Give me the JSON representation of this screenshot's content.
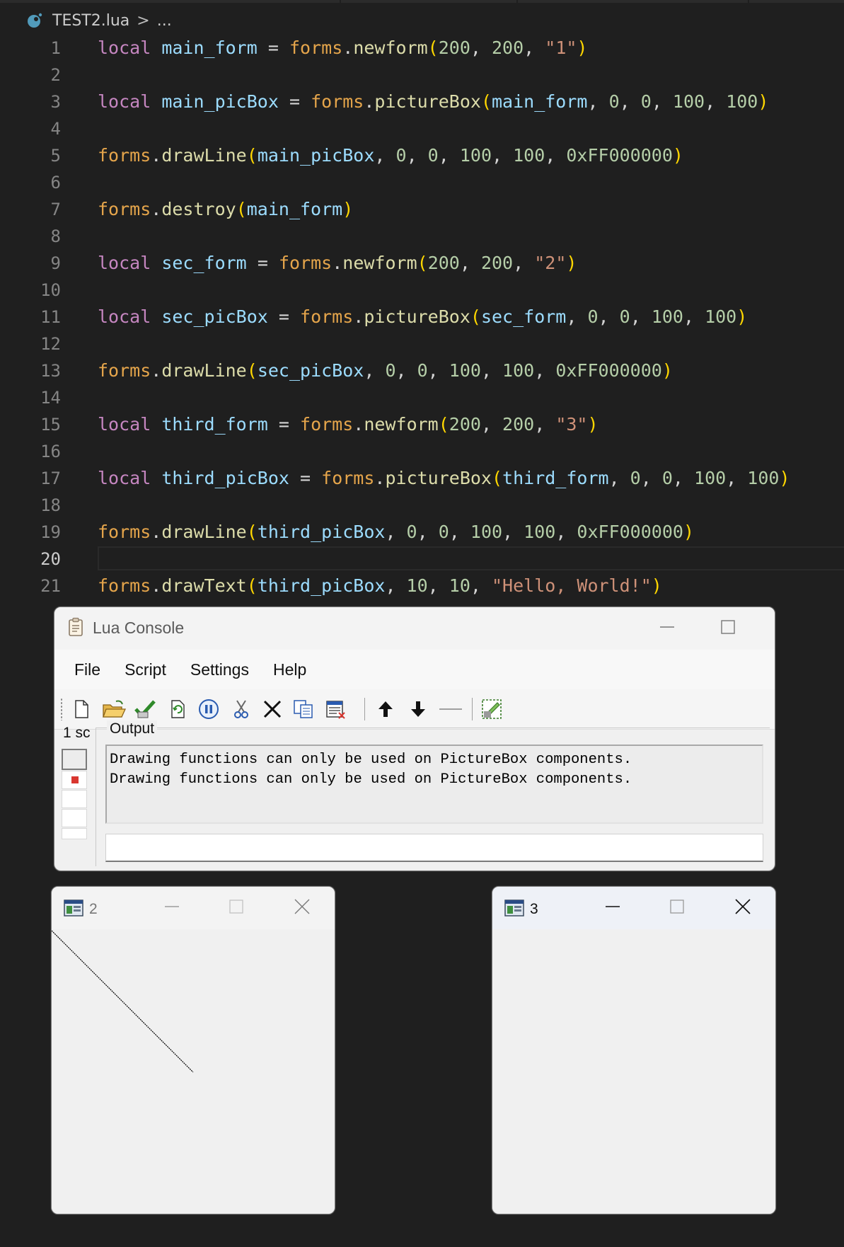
{
  "editor": {
    "breadcrumb": {
      "file": "TEST2.lua",
      "separator": ">",
      "rest": "..."
    },
    "active_line": 20,
    "lines": [
      {
        "n": "1",
        "tokens": [
          [
            "kw",
            "local"
          ],
          [
            "pl",
            " "
          ],
          [
            "var",
            "main_form"
          ],
          [
            "pl",
            " "
          ],
          [
            "op",
            "="
          ],
          [
            "pl",
            " "
          ],
          [
            "lib",
            "forms"
          ],
          [
            "op",
            "."
          ],
          [
            "fn",
            "newform"
          ],
          [
            "p1",
            "("
          ],
          [
            "num",
            "200"
          ],
          [
            "pl",
            ", "
          ],
          [
            "num",
            "200"
          ],
          [
            "pl",
            ", "
          ],
          [
            "str",
            "\"1\""
          ],
          [
            "p1",
            ")"
          ]
        ]
      },
      {
        "n": "2",
        "tokens": []
      },
      {
        "n": "3",
        "tokens": [
          [
            "kw",
            "local"
          ],
          [
            "pl",
            " "
          ],
          [
            "var",
            "main_picBox"
          ],
          [
            "pl",
            " "
          ],
          [
            "op",
            "="
          ],
          [
            "pl",
            " "
          ],
          [
            "lib",
            "forms"
          ],
          [
            "op",
            "."
          ],
          [
            "fn",
            "pictureBox"
          ],
          [
            "p1",
            "("
          ],
          [
            "var",
            "main_form"
          ],
          [
            "pl",
            ", "
          ],
          [
            "num",
            "0"
          ],
          [
            "pl",
            ", "
          ],
          [
            "num",
            "0"
          ],
          [
            "pl",
            ", "
          ],
          [
            "num",
            "100"
          ],
          [
            "pl",
            ", "
          ],
          [
            "num",
            "100"
          ],
          [
            "p1",
            ")"
          ]
        ]
      },
      {
        "n": "4",
        "tokens": []
      },
      {
        "n": "5",
        "tokens": [
          [
            "lib",
            "forms"
          ],
          [
            "op",
            "."
          ],
          [
            "fn",
            "drawLine"
          ],
          [
            "p1",
            "("
          ],
          [
            "var",
            "main_picBox"
          ],
          [
            "pl",
            ", "
          ],
          [
            "num",
            "0"
          ],
          [
            "pl",
            ", "
          ],
          [
            "num",
            "0"
          ],
          [
            "pl",
            ", "
          ],
          [
            "num",
            "100"
          ],
          [
            "pl",
            ", "
          ],
          [
            "num",
            "100"
          ],
          [
            "pl",
            ", "
          ],
          [
            "num",
            "0xFF000000"
          ],
          [
            "p1",
            ")"
          ]
        ]
      },
      {
        "n": "6",
        "tokens": []
      },
      {
        "n": "7",
        "tokens": [
          [
            "lib",
            "forms"
          ],
          [
            "op",
            "."
          ],
          [
            "fn",
            "destroy"
          ],
          [
            "p1",
            "("
          ],
          [
            "var",
            "main_form"
          ],
          [
            "p1",
            ")"
          ]
        ]
      },
      {
        "n": "8",
        "tokens": []
      },
      {
        "n": "9",
        "tokens": [
          [
            "kw",
            "local"
          ],
          [
            "pl",
            " "
          ],
          [
            "var",
            "sec_form"
          ],
          [
            "pl",
            " "
          ],
          [
            "op",
            "="
          ],
          [
            "pl",
            " "
          ],
          [
            "lib",
            "forms"
          ],
          [
            "op",
            "."
          ],
          [
            "fn",
            "newform"
          ],
          [
            "p1",
            "("
          ],
          [
            "num",
            "200"
          ],
          [
            "pl",
            ", "
          ],
          [
            "num",
            "200"
          ],
          [
            "pl",
            ", "
          ],
          [
            "str",
            "\"2\""
          ],
          [
            "p1",
            ")"
          ]
        ]
      },
      {
        "n": "10",
        "tokens": []
      },
      {
        "n": "11",
        "tokens": [
          [
            "kw",
            "local"
          ],
          [
            "pl",
            " "
          ],
          [
            "var",
            "sec_picBox"
          ],
          [
            "pl",
            " "
          ],
          [
            "op",
            "="
          ],
          [
            "pl",
            " "
          ],
          [
            "lib",
            "forms"
          ],
          [
            "op",
            "."
          ],
          [
            "fn",
            "pictureBox"
          ],
          [
            "p1",
            "("
          ],
          [
            "var",
            "sec_form"
          ],
          [
            "pl",
            ", "
          ],
          [
            "num",
            "0"
          ],
          [
            "pl",
            ", "
          ],
          [
            "num",
            "0"
          ],
          [
            "pl",
            ", "
          ],
          [
            "num",
            "100"
          ],
          [
            "pl",
            ", "
          ],
          [
            "num",
            "100"
          ],
          [
            "p1",
            ")"
          ]
        ]
      },
      {
        "n": "12",
        "tokens": []
      },
      {
        "n": "13",
        "tokens": [
          [
            "lib",
            "forms"
          ],
          [
            "op",
            "."
          ],
          [
            "fn",
            "drawLine"
          ],
          [
            "p1",
            "("
          ],
          [
            "var",
            "sec_picBox"
          ],
          [
            "pl",
            ", "
          ],
          [
            "num",
            "0"
          ],
          [
            "pl",
            ", "
          ],
          [
            "num",
            "0"
          ],
          [
            "pl",
            ", "
          ],
          [
            "num",
            "100"
          ],
          [
            "pl",
            ", "
          ],
          [
            "num",
            "100"
          ],
          [
            "pl",
            ", "
          ],
          [
            "num",
            "0xFF000000"
          ],
          [
            "p1",
            ")"
          ]
        ]
      },
      {
        "n": "14",
        "tokens": []
      },
      {
        "n": "15",
        "tokens": [
          [
            "kw",
            "local"
          ],
          [
            "pl",
            " "
          ],
          [
            "var",
            "third_form"
          ],
          [
            "pl",
            " "
          ],
          [
            "op",
            "="
          ],
          [
            "pl",
            " "
          ],
          [
            "lib",
            "forms"
          ],
          [
            "op",
            "."
          ],
          [
            "fn",
            "newform"
          ],
          [
            "p1",
            "("
          ],
          [
            "num",
            "200"
          ],
          [
            "pl",
            ", "
          ],
          [
            "num",
            "200"
          ],
          [
            "pl",
            ", "
          ],
          [
            "str",
            "\"3\""
          ],
          [
            "p1",
            ")"
          ]
        ]
      },
      {
        "n": "16",
        "tokens": []
      },
      {
        "n": "17",
        "tokens": [
          [
            "kw",
            "local"
          ],
          [
            "pl",
            " "
          ],
          [
            "var",
            "third_picBox"
          ],
          [
            "pl",
            " "
          ],
          [
            "op",
            "="
          ],
          [
            "pl",
            " "
          ],
          [
            "lib",
            "forms"
          ],
          [
            "op",
            "."
          ],
          [
            "fn",
            "pictureBox"
          ],
          [
            "p1",
            "("
          ],
          [
            "var",
            "third_form"
          ],
          [
            "pl",
            ", "
          ],
          [
            "num",
            "0"
          ],
          [
            "pl",
            ", "
          ],
          [
            "num",
            "0"
          ],
          [
            "pl",
            ", "
          ],
          [
            "num",
            "100"
          ],
          [
            "pl",
            ", "
          ],
          [
            "num",
            "100"
          ],
          [
            "p1",
            ")"
          ]
        ]
      },
      {
        "n": "18",
        "tokens": []
      },
      {
        "n": "19",
        "tokens": [
          [
            "lib",
            "forms"
          ],
          [
            "op",
            "."
          ],
          [
            "fn",
            "drawLine"
          ],
          [
            "p1",
            "("
          ],
          [
            "var",
            "third_picBox"
          ],
          [
            "pl",
            ", "
          ],
          [
            "num",
            "0"
          ],
          [
            "pl",
            ", "
          ],
          [
            "num",
            "0"
          ],
          [
            "pl",
            ", "
          ],
          [
            "num",
            "100"
          ],
          [
            "pl",
            ", "
          ],
          [
            "num",
            "100"
          ],
          [
            "pl",
            ", "
          ],
          [
            "num",
            "0xFF000000"
          ],
          [
            "p1",
            ")"
          ]
        ]
      },
      {
        "n": "20",
        "tokens": []
      },
      {
        "n": "21",
        "tokens": [
          [
            "lib",
            "forms"
          ],
          [
            "op",
            "."
          ],
          [
            "fn",
            "drawText"
          ],
          [
            "p1",
            "("
          ],
          [
            "var",
            "third_picBox"
          ],
          [
            "pl",
            ", "
          ],
          [
            "num",
            "10"
          ],
          [
            "pl",
            ", "
          ],
          [
            "num",
            "10"
          ],
          [
            "pl",
            ", "
          ],
          [
            "str",
            "\"Hello, World!\""
          ],
          [
            "p1",
            ")"
          ]
        ]
      }
    ]
  },
  "console": {
    "title": "Lua Console",
    "menu": [
      "File",
      "Script",
      "Settings",
      "Help"
    ],
    "toolbar_icons": [
      "new-script-icon",
      "open-folder-icon",
      "toggle-check-icon",
      "reload-icon",
      "pause-icon",
      "cut-icon",
      "remove-x-icon",
      "copy-icon",
      "clear-list-icon",
      "move-up-icon",
      "move-down-icon",
      "separator-line-icon",
      "register-edit-icon"
    ],
    "scripts_label": "1 sc",
    "output_label": "Output",
    "output_lines": [
      "Drawing functions can only be used on PictureBox components.",
      "Drawing functions can only be used on PictureBox components."
    ],
    "input_value": ""
  },
  "forms": [
    {
      "title": "2"
    },
    {
      "title": "3"
    }
  ],
  "colors": {
    "background": "#1f1f1f",
    "keyword": "#c586c0",
    "variable": "#9cdcfe",
    "library": "#e5a54b",
    "function": "#dcdcaa",
    "number": "#b5cea8",
    "string": "#ce9178",
    "bracket": "#ffd700"
  }
}
